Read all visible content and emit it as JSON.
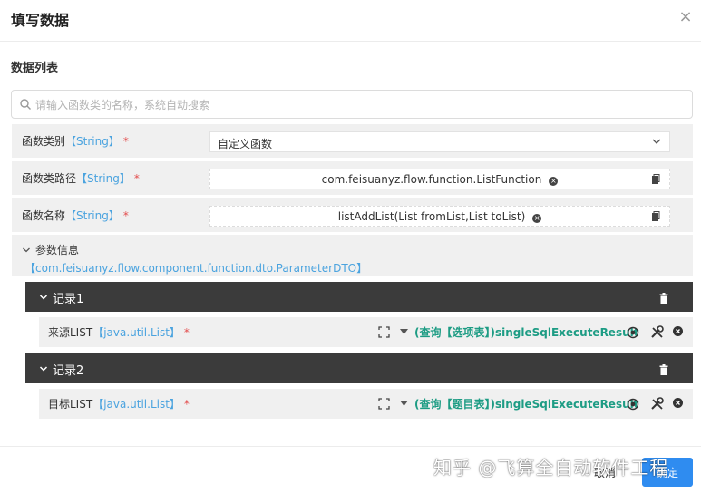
{
  "dialog": {
    "title": "填写数据",
    "close_label": "×"
  },
  "section": {
    "title": "数据列表"
  },
  "search": {
    "placeholder": "请输入函数类的名称，系统自动搜索"
  },
  "fields": [
    {
      "label": "函数类别",
      "type": "【String】",
      "required": "*",
      "value": "自定义函数"
    },
    {
      "label": "函数类路径",
      "type": "【String】",
      "required": "*",
      "value": "com.feisuanyz.flow.function.ListFunction"
    },
    {
      "label": "函数名称",
      "type": "【String】",
      "required": "*",
      "value": "listAddList(List fromList,List toList)"
    }
  ],
  "param_info": {
    "label": "参数信息",
    "type": "【com.feisuanyz.flow.component.function.dto.ParameterDTO】"
  },
  "records": [
    {
      "name": "记录1",
      "label": "来源LIST",
      "type": "【java.util.List】",
      "required": "*",
      "expression": "(查询【选项表】)singleSqlExecuteResult"
    },
    {
      "name": "记录2",
      "label": "目标LIST",
      "type": "【java.util.List】",
      "required": "*",
      "expression": "(查询【题目表】)singleSqlExecuteResult"
    }
  ],
  "footer": {
    "cancel_label": "取消",
    "ok_label": "确定",
    "watermark": "知乎 @飞算全自动软件工程"
  },
  "colors": {
    "accent": "#2f8cf0",
    "type_blue": "#4aa3df",
    "expr_green": "#1d9c84",
    "required_red": "#e34d4d",
    "record_header": "#3b3b3b"
  }
}
